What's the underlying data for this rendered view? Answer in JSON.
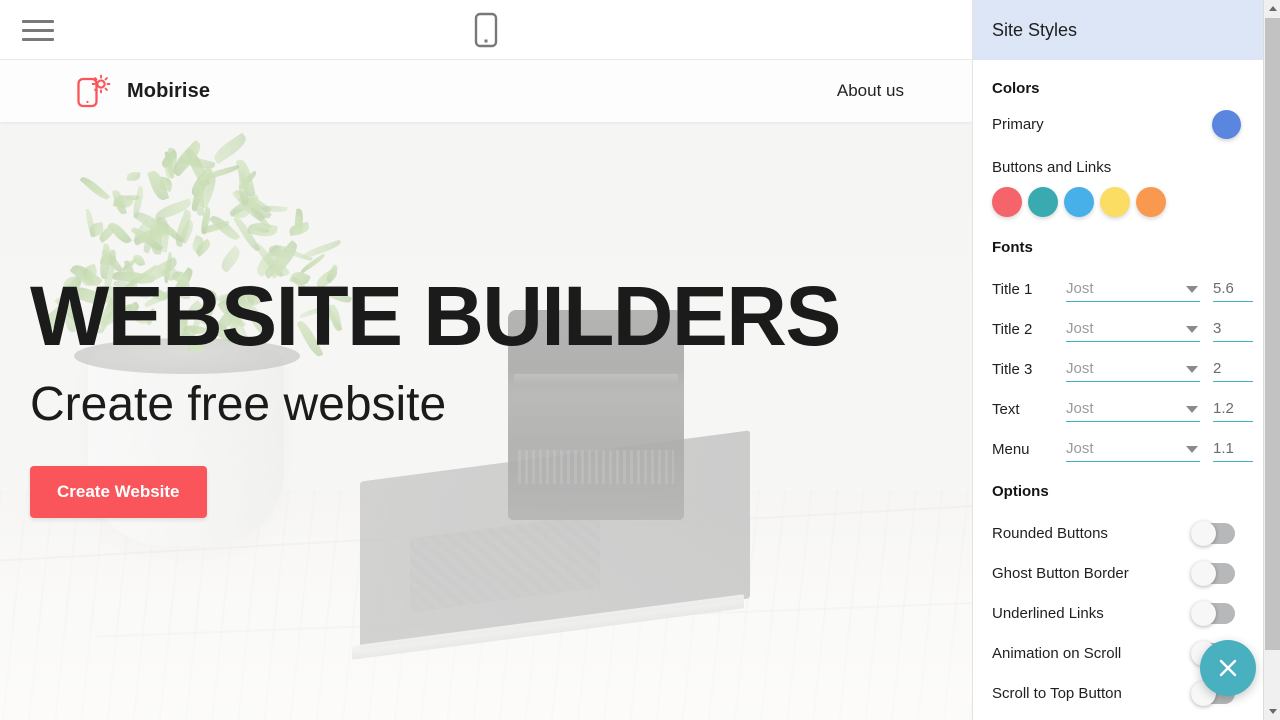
{
  "toolbar": {
    "menu_icon": "hamburger-menu-icon",
    "device_icon": "mobile-device-icon"
  },
  "site": {
    "brand_name": "Mobirise",
    "brand_logo_icon": "mobirise-logo-icon",
    "nav_links": [
      {
        "label": "About us"
      }
    ],
    "hero": {
      "title": "WEBSITE BUILDERS",
      "subtitle": "Create free website",
      "button_label": "Create Website",
      "button_color": "#f9555a"
    }
  },
  "panel": {
    "title": "Site Styles",
    "header_bg": "#dce6f6",
    "colors": {
      "section_title": "Colors",
      "primary_label": "Primary",
      "primary_color": "#5b86e0",
      "buttons_links_label": "Buttons and Links",
      "buttons_links_colors": [
        "#f4646a",
        "#3aaab1",
        "#47b0e8",
        "#fadd62",
        "#f9994f"
      ]
    },
    "fonts": {
      "section_title": "Fonts",
      "rows": [
        {
          "label": "Title 1",
          "font": "Jost",
          "size": "5.6"
        },
        {
          "label": "Title 2",
          "font": "Jost",
          "size": "3"
        },
        {
          "label": "Title 3",
          "font": "Jost",
          "size": "2"
        },
        {
          "label": "Text",
          "font": "Jost",
          "size": "1.2"
        },
        {
          "label": "Menu",
          "font": "Jost",
          "size": "1.1"
        }
      ],
      "underline_color": "#3eb0c4",
      "dropdown_icon": "chevron-down-icon"
    },
    "options": {
      "section_title": "Options",
      "rows": [
        {
          "label": "Rounded Buttons",
          "enabled": "off"
        },
        {
          "label": "Ghost Button Border",
          "enabled": "off"
        },
        {
          "label": "Underlined Links",
          "enabled": "off"
        },
        {
          "label": "Animation on Scroll",
          "enabled": "off"
        },
        {
          "label": "Scroll to Top Button",
          "enabled": "off"
        }
      ]
    },
    "close_button": {
      "icon": "close-x-icon",
      "color": "#49b0c0"
    }
  },
  "scrollbar": {
    "up_icon": "scroll-up-arrow-icon",
    "down_icon": "scroll-down-arrow-icon",
    "thumb": "scrollbar-thumb"
  }
}
